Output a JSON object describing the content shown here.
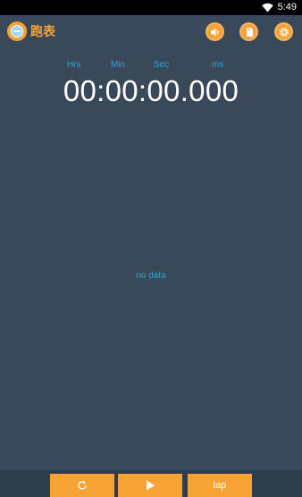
{
  "status_bar": {
    "time": "5:49",
    "icons": [
      "wifi-icon"
    ]
  },
  "app": {
    "title": "跑表",
    "logo_icon": "stopwatch-logo-icon"
  },
  "toolbar": {
    "icons": [
      "speaker-icon",
      "sd-card-icon",
      "gear-icon"
    ]
  },
  "timer": {
    "units": {
      "hrs": "Hrs",
      "min": "Min",
      "sec": "Sec",
      "ms": "ms"
    },
    "display": "00:00:00.000"
  },
  "laps": {
    "empty_text": "no data"
  },
  "controls": {
    "reset_icon": "reset-icon",
    "start_icon": "play-icon",
    "lap_label": "lap"
  },
  "colors": {
    "background": "#39495a",
    "accent": "#f6a235",
    "label_blue": "#2aa7d8",
    "text": "#ffffff"
  }
}
